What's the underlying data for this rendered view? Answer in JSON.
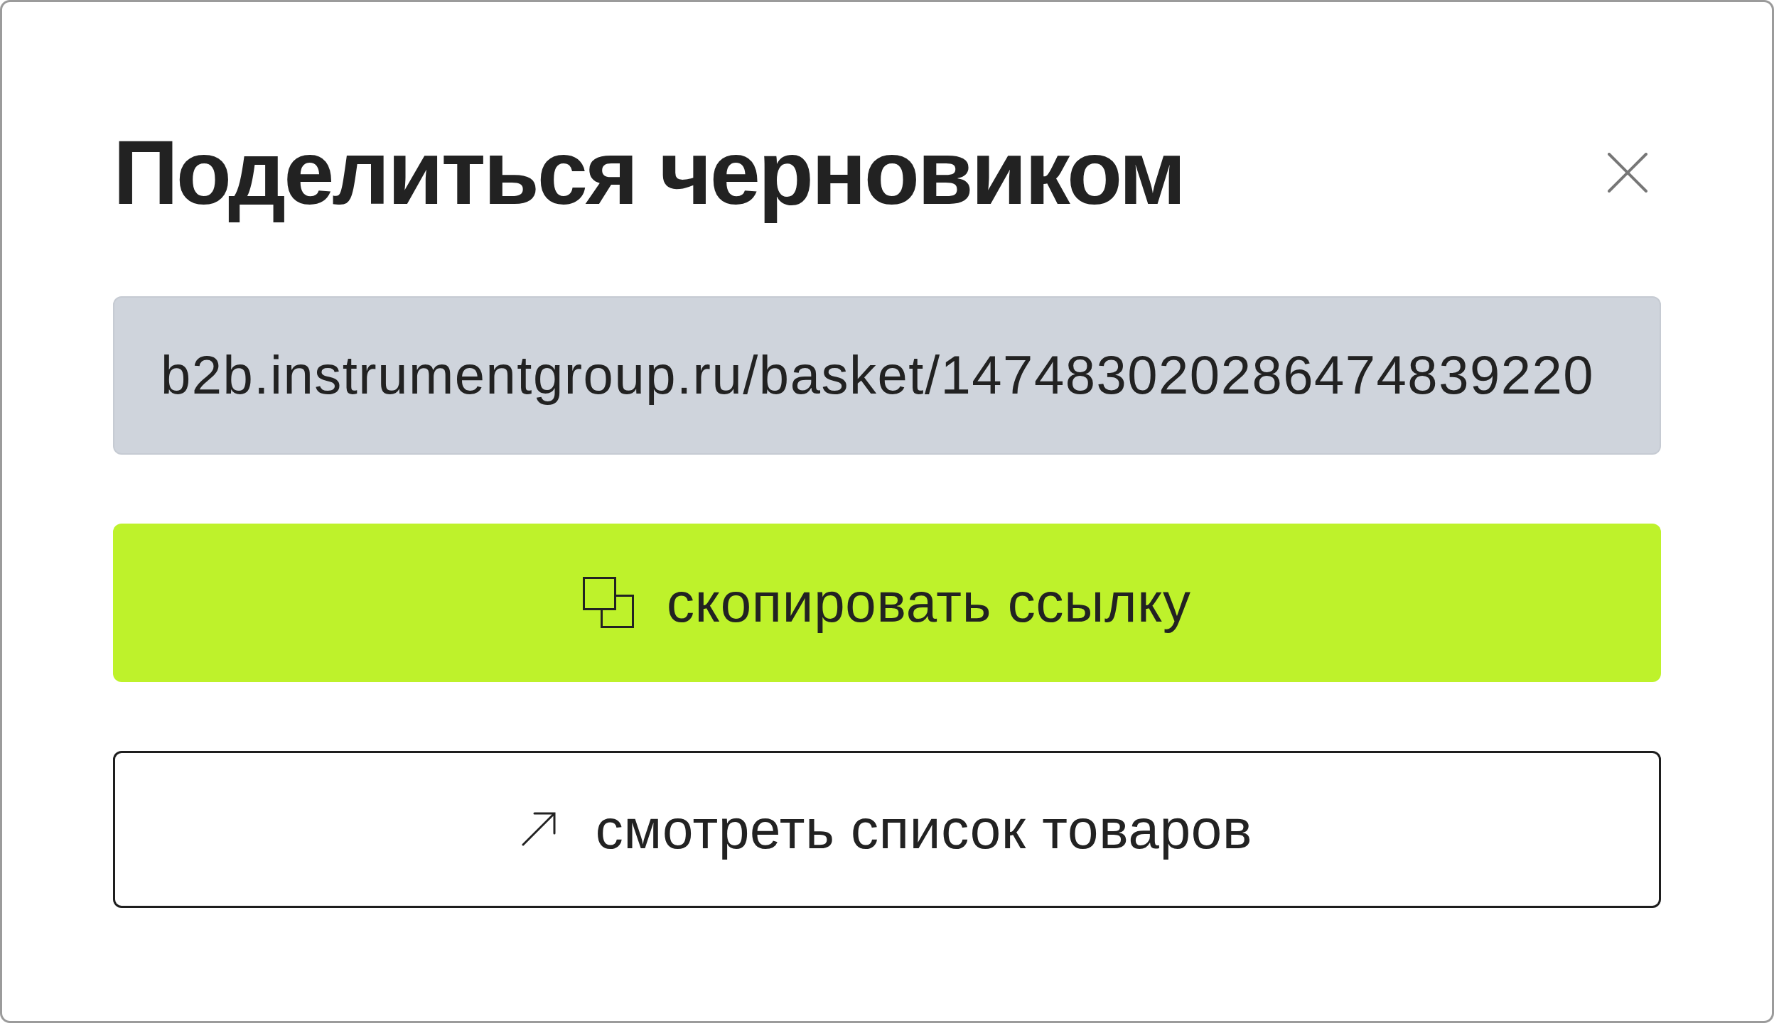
{
  "dialog": {
    "title": "Поделиться черновиком",
    "link_field": {
      "value": "b2b.instrumentgroup.ru/basket/147483020286474839220"
    },
    "buttons": [
      {
        "label": "скопировать ссылку",
        "kind": "primary"
      },
      {
        "label": "смотреть список товаров",
        "kind": "secondary"
      }
    ]
  }
}
